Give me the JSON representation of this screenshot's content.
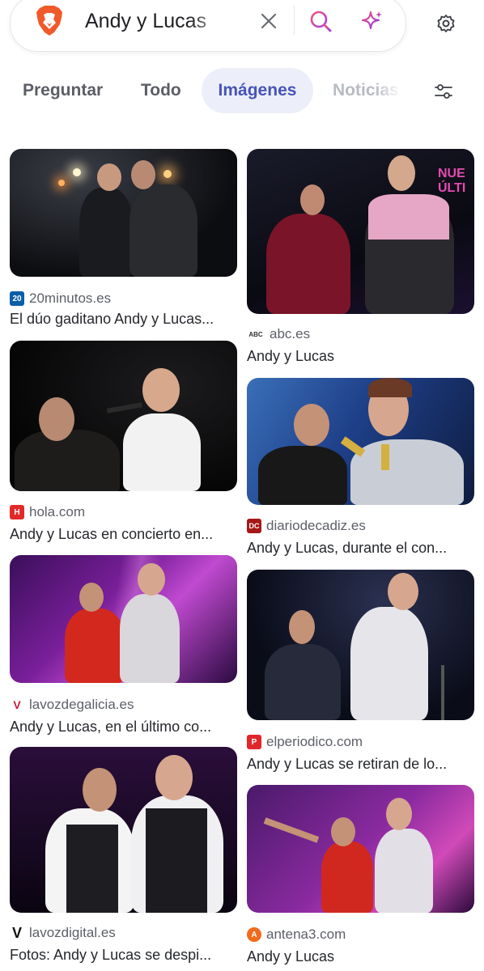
{
  "search": {
    "query": "Andy y Lucas",
    "clear_icon": "close-icon",
    "search_icon": "search-icon",
    "ai_icon": "sparkle-icon",
    "settings_icon": "gear-icon"
  },
  "tabs": [
    {
      "label": "Preguntar",
      "active": false
    },
    {
      "label": "Todo",
      "active": false
    },
    {
      "label": "Imágenes",
      "active": true
    },
    {
      "label": "Noticias",
      "active": false
    }
  ],
  "colors": {
    "active_tab_bg": "#eceff9",
    "active_tab_text": "#4753b8",
    "brave_orange": "#f05a2a"
  },
  "results": [
    {
      "source": "20minutos.es",
      "title": "El dúo gaditano Andy y Lucas...",
      "favicon_text": "20"
    },
    {
      "source": "abc.es",
      "title": "Andy y Lucas",
      "favicon_text": "ABC"
    },
    {
      "source": "hola.com",
      "title": "Andy y Lucas en concierto en...",
      "favicon_text": "H"
    },
    {
      "source": "diariodecadiz.es",
      "title": "Andy y Lucas, durante el con...",
      "favicon_text": "DC"
    },
    {
      "source": "lavozdegalicia.es",
      "title": "Andy y Lucas, en el último co...",
      "favicon_text": "V"
    },
    {
      "source": "elperiodico.com",
      "title": "Andy y Lucas se retiran de lo...",
      "favicon_text": "P"
    },
    {
      "source": "lavozdigital.es",
      "title": "Fotos: Andy y Lucas se despi...",
      "favicon_text": "V"
    },
    {
      "source": "antena3.com",
      "title": "Andy y Lucas",
      "favicon_text": "A"
    }
  ]
}
